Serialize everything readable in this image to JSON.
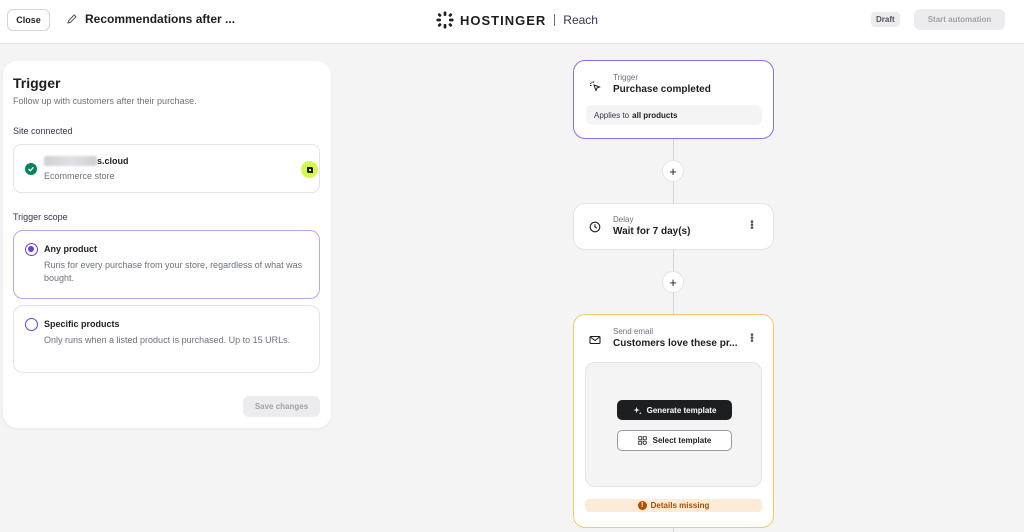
{
  "header": {
    "close_label": "Close",
    "title": "Recommendations after ...",
    "brand_name": "HOSTINGER",
    "brand_product": "Reach",
    "status_badge": "Draft",
    "start_label": "Start automation"
  },
  "trigger_panel": {
    "title": "Trigger",
    "subtitle": "Follow up with customers after their purchase.",
    "site_section_label": "Site connected",
    "site": {
      "name": "s.cloud",
      "type": "Ecommerce store"
    },
    "scope_label": "Trigger scope",
    "options": [
      {
        "title": "Any product",
        "description": "Runs for every purchase from your store, regardless of what was bought.",
        "selected": true
      },
      {
        "title": "Specific products",
        "description": "Only runs when a listed product is purchased. Up to 15 URLs.",
        "selected": false
      }
    ],
    "save_label": "Save changes"
  },
  "flow": {
    "trigger_node": {
      "label": "Trigger",
      "title": "Purchase completed",
      "applies_prefix": "Applies to",
      "applies_value": "all products"
    },
    "delay_node": {
      "label": "Delay",
      "title": "Wait for 7 day(s)"
    },
    "email_node": {
      "label": "Send email",
      "title": "Customers love these pr...",
      "generate_label": "Generate template",
      "select_label": "Select template",
      "missing_label": "Details missing"
    },
    "add_step_symbol": "+"
  },
  "colors": {
    "accent": "#673de6",
    "success": "#008361",
    "warning_border": "#f5c86a",
    "warning_text": "#a64d00",
    "trigger_border": "#8c6cf1"
  }
}
